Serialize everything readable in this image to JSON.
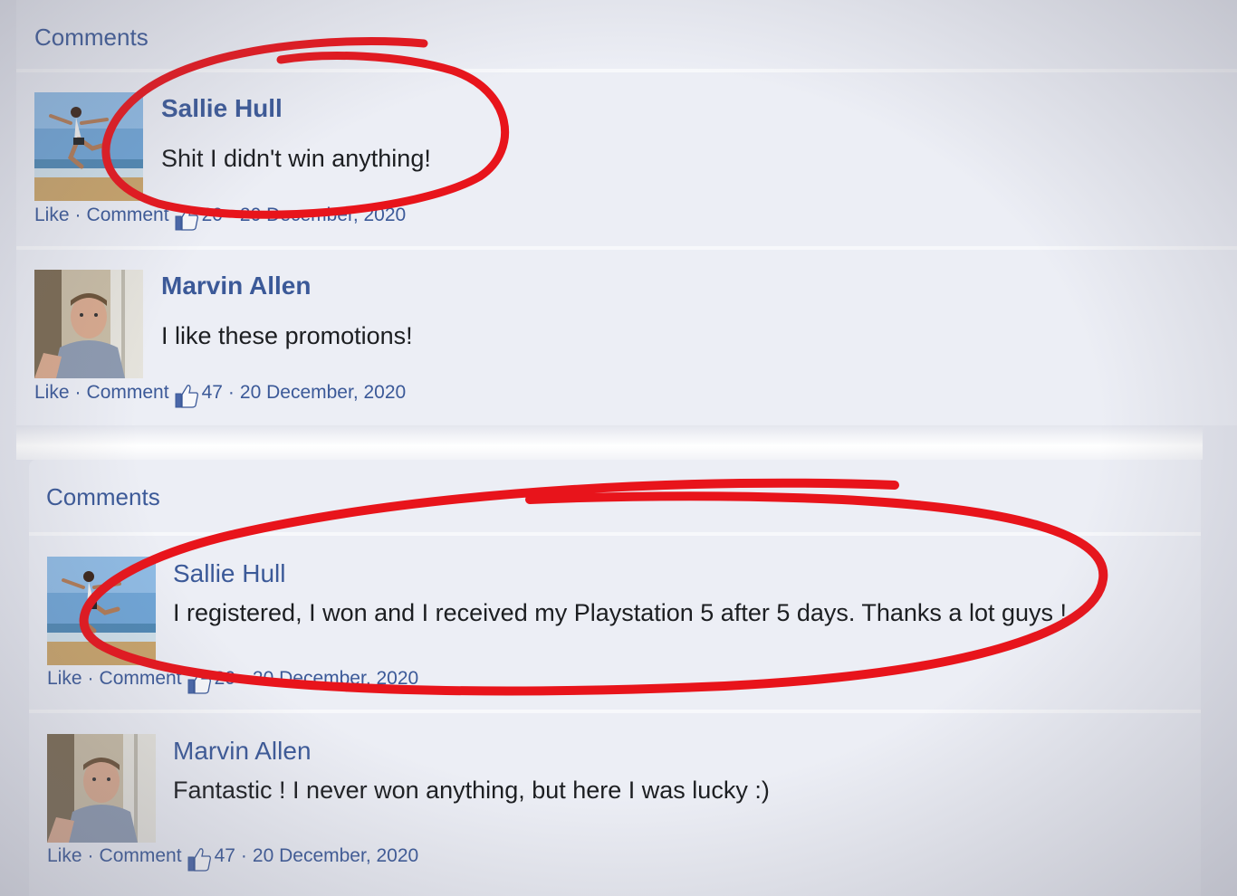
{
  "panels": [
    {
      "header": "Comments",
      "comments": [
        {
          "name": "Sallie Hull",
          "text": "Shit I didn't win anything!",
          "like": "Like",
          "comment": "Comment",
          "likes": "20",
          "date": "20 December, 2020",
          "avatar": "woman-jumping-beach"
        },
        {
          "name": "Marvin Allen",
          "text": "I like these promotions!",
          "like": "Like",
          "comment": "Comment",
          "likes": "47",
          "date": "20 December, 2020",
          "avatar": "man-selfie"
        }
      ]
    },
    {
      "header": "Comments",
      "comments": [
        {
          "name": "Sallie Hull",
          "text": "I registered, I won and I received my Playstation 5 after 5 days. Thanks a lot guys !",
          "like": "Like",
          "comment": "Comment",
          "likes": "20",
          "date": "20 December, 2020",
          "avatar": "woman-jumping-beach"
        },
        {
          "name": "Marvin Allen",
          "text": "Fantastic ! I never won anything, but here I was lucky :)",
          "like": "Like",
          "comment": "Comment",
          "likes": "47",
          "date": "20 December, 2020",
          "avatar": "man-selfie"
        }
      ]
    }
  ],
  "colors": {
    "link": "#3b5998",
    "annotation": "#e8141b",
    "text": "#1c1e21"
  }
}
